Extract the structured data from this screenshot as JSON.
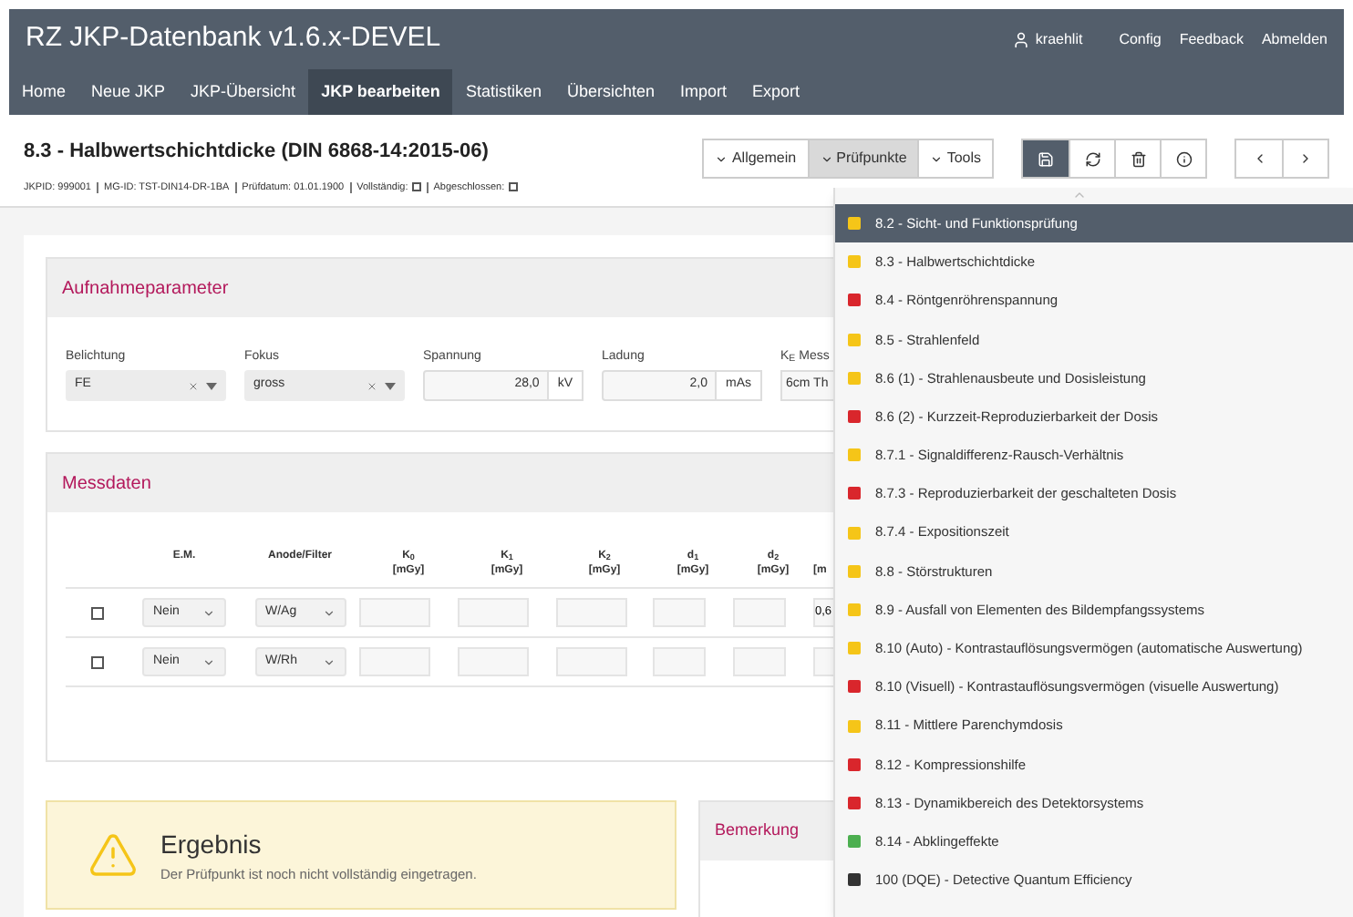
{
  "header": {
    "title": "RZ JKP-Datenbank v1.6.x-DEVEL",
    "user": "kraehlit",
    "links": [
      "Config",
      "Feedback",
      "Abmelden"
    ],
    "nav": [
      {
        "label": "Home",
        "selected": false
      },
      {
        "label": "Neue JKP",
        "selected": false
      },
      {
        "label": "JKP-Übersicht",
        "selected": false
      },
      {
        "label": "JKP bearbeiten",
        "selected": true
      },
      {
        "label": "Statistiken",
        "selected": false
      },
      {
        "label": "Übersichten",
        "selected": false
      },
      {
        "label": "Import",
        "selected": false
      },
      {
        "label": "Export",
        "selected": false
      }
    ]
  },
  "page": {
    "title": "8.3 - Halbwertschichtdicke (DIN 6868-14:2015-06)",
    "meta": [
      {
        "kind": "text",
        "label": "JKPID: 999001"
      },
      {
        "kind": "text",
        "label": "MG-ID: TST-DIN14-DR-1BA"
      },
      {
        "kind": "text",
        "label": "Prüfdatum: 01.01.1900"
      },
      {
        "kind": "checkbox",
        "label": "Vollständig:",
        "checked": false
      },
      {
        "kind": "checkbox",
        "label": "Abgeschlossen:",
        "checked": false
      }
    ]
  },
  "toolbar": {
    "menus": [
      {
        "label": "Allgemein",
        "selected": false
      },
      {
        "label": "Prüfpunkte",
        "selected": true
      },
      {
        "label": "Tools",
        "selected": false
      }
    ],
    "actions": [
      {
        "kind": "save",
        "primary": true
      },
      {
        "kind": "refresh",
        "primary": false
      },
      {
        "kind": "delete",
        "primary": false
      },
      {
        "kind": "info",
        "primary": false
      }
    ],
    "paging": [
      {
        "kind": "prev"
      },
      {
        "kind": "next"
      }
    ]
  },
  "aufnahme": {
    "title": "Aufnahmeparameter",
    "fields": [
      {
        "kind": "select",
        "label": "Belichtung",
        "value": "FE"
      },
      {
        "kind": "select",
        "label": "Fokus",
        "value": "gross"
      },
      {
        "kind": "unit",
        "label": "Spannung",
        "value": "28,0",
        "unit": "kV"
      },
      {
        "kind": "unit",
        "label": "Ladung",
        "value": "2,0",
        "unit": "mAs"
      },
      {
        "kind": "text",
        "label": "K$_{E}$ Mess",
        "value": "6cm Th"
      }
    ]
  },
  "messdaten": {
    "title": "Messdaten",
    "columns": [
      {
        "label": "E.M."
      },
      {
        "label": "Anode/Filter"
      },
      {
        "label": "K$_{0}$",
        "unit": "[mGy]"
      },
      {
        "label": "K$_{1}$",
        "unit": "[mGy]"
      },
      {
        "label": "K$_{2}$",
        "unit": "[mGy]"
      },
      {
        "label": "d$_{1}$",
        "unit": "[mGy]"
      },
      {
        "label": "d$_{2}$",
        "unit": "[mGy]"
      },
      {
        "unit": "[m"
      }
    ],
    "rows": [
      {
        "checked": false,
        "em": "Nein",
        "anode": "W/Ag",
        "column_8": "0,6"
      },
      {
        "checked": false,
        "em": "Nein",
        "anode": "W/Rh",
        "column_8": ""
      }
    ]
  },
  "ergebnis": {
    "title": "Ergebnis",
    "message": "Der Prüfpunkt ist noch nicht vollständig eingetragen."
  },
  "bemerkung": {
    "title": "Bemerkung"
  },
  "pruefpunkte": [
    {
      "label": "8.2 - Sicht- und Funktionsprüfung",
      "color": "#f5c518",
      "selected": true
    },
    {
      "label": "8.3 - Halbwertschichtdicke",
      "color": "#f5c518",
      "selected": false
    },
    {
      "label": "8.4 - Röntgenröhrenspannung",
      "color": "#d9262c",
      "selected": false
    },
    {
      "label": "8.5 - Strahlenfeld",
      "color": "#f5c518",
      "selected": false
    },
    {
      "label": "8.6 (1) - Strahlenausbeute und Dosisleistung",
      "color": "#f5c518",
      "selected": false
    },
    {
      "label": "8.6 (2) - Kurzzeit-Reproduzierbarkeit der Dosis",
      "color": "#d9262c",
      "selected": false
    },
    {
      "label": "8.7.1 - Signaldifferenz-Rausch-Verhältnis",
      "color": "#f5c518",
      "selected": false
    },
    {
      "label": "8.7.3 - Reproduzierbarkeit der geschalteten Dosis",
      "color": "#d9262c",
      "selected": false
    },
    {
      "label": "8.7.4 - Expositionszeit",
      "color": "#f5c518",
      "selected": false
    },
    {
      "label": "8.8 - Störstrukturen",
      "color": "#f5c518",
      "selected": false
    },
    {
      "label": "8.9 - Ausfall von Elementen des Bildempfangssystems",
      "color": "#f5c518",
      "selected": false
    },
    {
      "label": "8.10 (Auto) - Kontrastauflösungsvermögen (automatische Auswertung)",
      "color": "#f5c518",
      "selected": false
    },
    {
      "label": "8.10 (Visuell) - Kontrastauflösungsvermögen (visuelle Auswertung)",
      "color": "#d9262c",
      "selected": false
    },
    {
      "label": "8.11 - Mittlere Parenchymdosis",
      "color": "#f5c518",
      "selected": false
    },
    {
      "label": "8.12 - Kompressionshilfe",
      "color": "#d9262c",
      "selected": false
    },
    {
      "label": "8.13 - Dynamikbereich des Detektorsystems",
      "color": "#d9262c",
      "selected": false
    },
    {
      "label": "8.14 - Abklingeffekte",
      "color": "#4caf50",
      "selected": false
    },
    {
      "label": "100 (DQE) - Detective Quantum Efficiency",
      "color": "#333333",
      "selected": false
    }
  ]
}
